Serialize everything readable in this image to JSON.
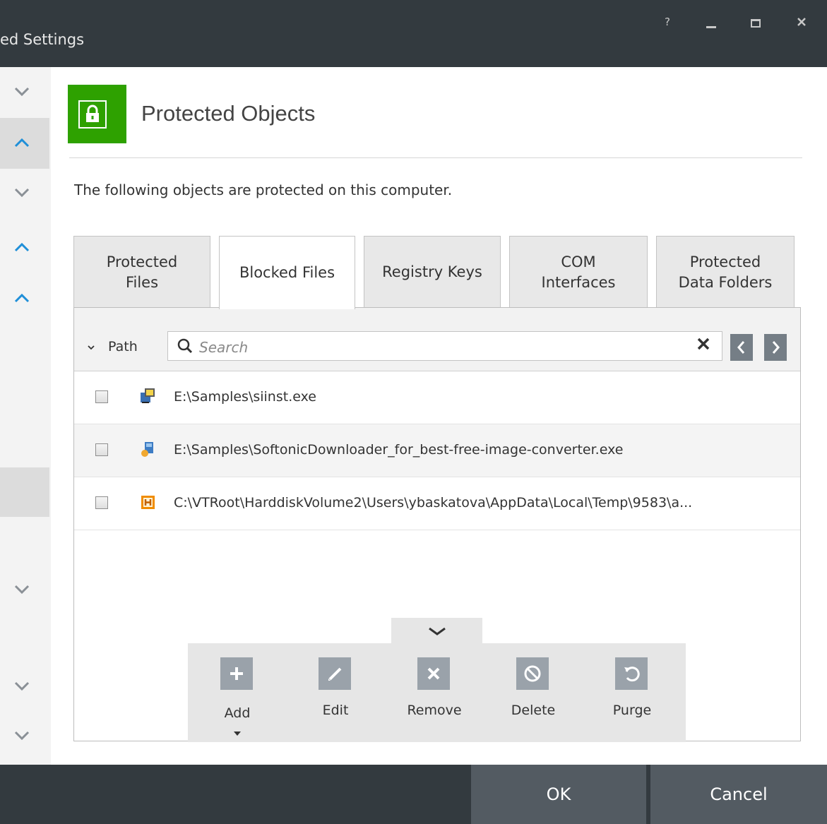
{
  "window": {
    "title": "ed Settings",
    "help_label": "?"
  },
  "header": {
    "title": "Protected Objects",
    "description": "The following objects are protected on this computer.",
    "icon": "lock-icon",
    "accent_color": "#2ea100"
  },
  "tabs": [
    {
      "label": "Protected\nFiles",
      "active": false
    },
    {
      "label": "Blocked Files",
      "active": true
    },
    {
      "label": "Registry Keys",
      "active": false
    },
    {
      "label": "COM\nInterfaces",
      "active": false
    },
    {
      "label": "Protected\nData Folders",
      "active": false
    }
  ],
  "filter": {
    "column_label": "Path",
    "search_placeholder": "Search"
  },
  "rows": [
    {
      "path": "E:\\Samples\\siinst.exe",
      "icon": "installer-icon",
      "checked": false
    },
    {
      "path": "E:\\Samples\\SoftonicDownloader_for_best-free-image-converter.exe",
      "icon": "setup-icon",
      "checked": false
    },
    {
      "path": "C:\\VTRoot\\HarddiskVolume2\\Users\\ybaskatova\\AppData\\Local\\Temp\\9583\\a...",
      "icon": "h-app-icon",
      "checked": false
    }
  ],
  "toolbar": {
    "add": "Add",
    "edit": "Edit",
    "remove": "Remove",
    "delete": "Delete",
    "purge": "Purge"
  },
  "footer": {
    "ok": "OK",
    "cancel": "Cancel"
  }
}
